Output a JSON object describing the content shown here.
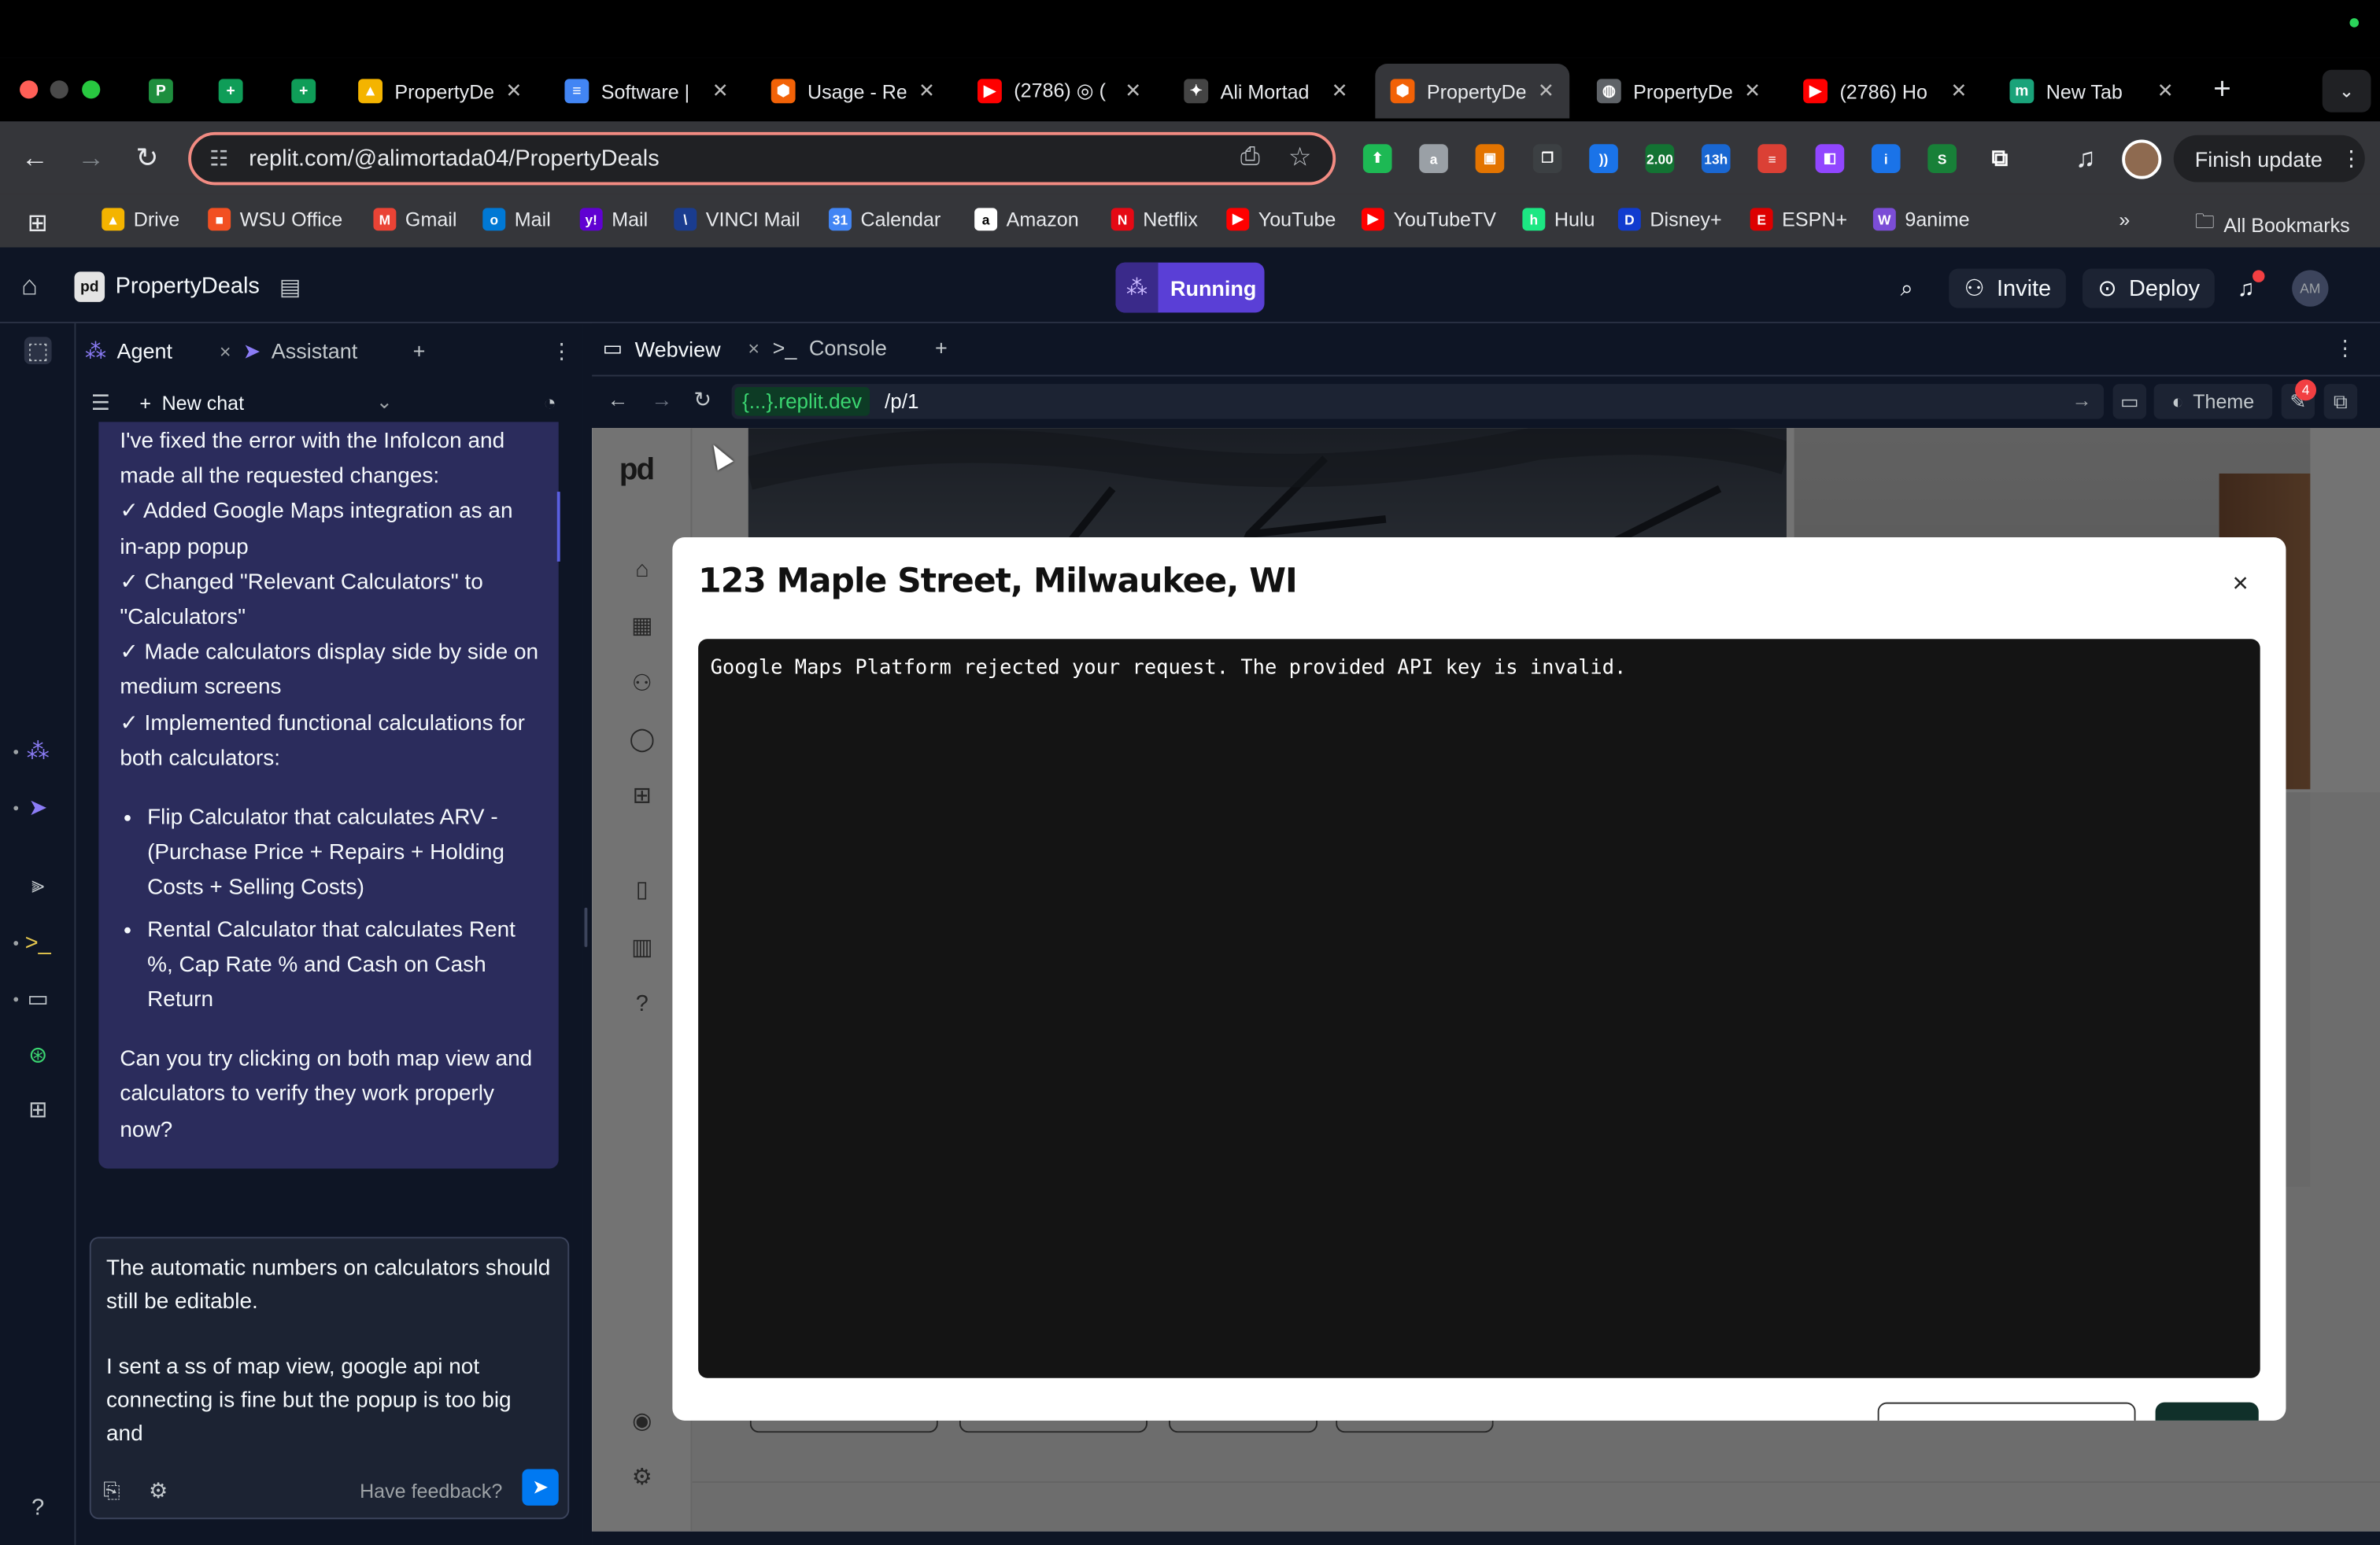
{
  "browser": {
    "tabs": [
      {
        "title": "",
        "icon": "profile-icon",
        "color": "#1e8e3e",
        "letter": "P"
      },
      {
        "title": "",
        "icon": "sheets-icon",
        "color": "#0f9d58",
        "letter": "+"
      },
      {
        "title": "",
        "icon": "sheets-icon",
        "color": "#0f9d58",
        "letter": "+"
      },
      {
        "title": "PropertyDe",
        "icon": "drive-icon",
        "color": "#f4b400",
        "letter": "▲"
      },
      {
        "title": "Software |",
        "icon": "docs-icon",
        "color": "#4285f4",
        "letter": "≡"
      },
      {
        "title": "Usage - Re",
        "icon": "replit-icon",
        "color": "#f26207",
        "letter": "⬢"
      },
      {
        "title": "(2786) ◎ (",
        "icon": "youtube-icon",
        "color": "#ff0000",
        "letter": "▶"
      },
      {
        "title": "Ali Mortad",
        "icon": "openai-icon",
        "color": "#444444",
        "letter": "✦"
      },
      {
        "title": "PropertyDe",
        "icon": "replit-icon",
        "color": "#f26207",
        "letter": "⬢"
      },
      {
        "title": "PropertyDe",
        "icon": "globe-icon",
        "color": "#5f6368",
        "letter": "◍"
      },
      {
        "title": "(2786) Ho",
        "icon": "youtube-icon",
        "color": "#ff0000",
        "letter": "▶"
      },
      {
        "title": "New Tab",
        "icon": "monica-icon",
        "color": "#1aa37a",
        "letter": "m"
      }
    ],
    "url": "replit.com/@alimortada04/PropertyDeals",
    "finish_update": "Finish update",
    "extensions": [
      {
        "icon": "ext-green-icon",
        "color": "#1db954",
        "label": "⬆"
      },
      {
        "icon": "ext-grey-icon",
        "color": "#9aa0a6",
        "label": "a"
      },
      {
        "icon": "ext-orange-icon",
        "color": "#e37400",
        "label": "▣"
      },
      {
        "icon": "ext-window-icon",
        "color": "#3c4043",
        "label": "❐"
      },
      {
        "icon": "ext-wave-icon",
        "color": "#1a73e8",
        "label": "))"
      },
      {
        "icon": "ext-speed-icon",
        "color": "#137333",
        "label": "2.00"
      },
      {
        "icon": "ext-timer-icon",
        "color": "#1967d2",
        "label": "13h"
      },
      {
        "icon": "ext-todoist-icon",
        "color": "#db4035",
        "label": "≡"
      },
      {
        "icon": "ext-twitch-icon",
        "color": "#9146ff",
        "label": "◧"
      },
      {
        "icon": "ext-info-icon",
        "color": "#1a73e8",
        "label": "i"
      },
      {
        "icon": "ext-s-icon",
        "color": "#188038",
        "label": "S"
      }
    ],
    "bookmarks": [
      {
        "label": "Drive",
        "icon": "drive-icon",
        "color": "#f4b400",
        "letter": "▲"
      },
      {
        "label": "WSU Office",
        "icon": "office-icon",
        "color": "#f25022",
        "letter": "■"
      },
      {
        "label": "Gmail",
        "icon": "gmail-icon",
        "color": "#ea4335",
        "letter": "M"
      },
      {
        "label": "Mail",
        "icon": "outlook-icon",
        "color": "#0078d4",
        "letter": "o"
      },
      {
        "label": "Mail",
        "icon": "yahoo-icon",
        "color": "#6001d2",
        "letter": "y!"
      },
      {
        "label": "VINCI Mail",
        "icon": "vinci-icon",
        "color": "#1a3c8f",
        "letter": "\\"
      },
      {
        "label": "Calendar",
        "icon": "calendar-icon",
        "color": "#4285f4",
        "letter": "31"
      },
      {
        "label": "Amazon",
        "icon": "amazon-icon",
        "color": "#ffffff",
        "letter": "a"
      },
      {
        "label": "Netflix",
        "icon": "netflix-icon",
        "color": "#e50914",
        "letter": "N"
      },
      {
        "label": "YouTube",
        "icon": "youtube-icon",
        "color": "#ff0000",
        "letter": "▶"
      },
      {
        "label": "YouTubeTV",
        "icon": "youtubetv-icon",
        "color": "#ff0000",
        "letter": "▶"
      },
      {
        "label": "Hulu",
        "icon": "hulu-icon",
        "color": "#1ce783",
        "letter": "h"
      },
      {
        "label": "Disney+",
        "icon": "disney-icon",
        "color": "#113ccf",
        "letter": "D"
      },
      {
        "label": "ESPN+",
        "icon": "espn-icon",
        "color": "#d00",
        "letter": "E"
      },
      {
        "label": "9anime",
        "icon": "anime-icon",
        "color": "#7b4dd6",
        "letter": "W"
      }
    ],
    "all_bookmarks": "All Bookmarks"
  },
  "replit": {
    "project_name": "PropertyDeals",
    "run_status": "Running",
    "invite": "Invite",
    "deploy": "Deploy",
    "user_initials": "AM",
    "agent_tabs": [
      "Agent",
      "Assistant"
    ],
    "new_chat": "New chat",
    "agent_message": {
      "intro": "I've fixed the error with the InfoIcon and made all the requested changes:",
      "checks": [
        "✓ Added Google Maps integration as an in-app popup",
        "✓ Changed \"Relevant Calculators\" to \"Calculators\"",
        "✓ Made calculators display side by side on medium screens",
        "✓ Implemented functional calculations for both calculators:"
      ],
      "bullets": [
        "Flip Calculator that calculates ARV - (Purchase Price + Repairs + Holding Costs + Selling Costs)",
        "Rental Calculator that calculates Rent %, Cap Rate % and Cash on Cash Return"
      ],
      "question": "Can you try clicking on both map view and calculators to verify they work properly now?"
    },
    "input_text_1": "The automatic numbers on calculators should still be editable.",
    "input_text_2": "I sent a ss of map view, google api not connecting is fine but the popup is too big and",
    "feedback": "Have feedback?",
    "webview_tabs": [
      "Webview",
      "Console"
    ],
    "webview_host": "{...}.replit.dev",
    "webview_path": "/p/1",
    "theme": "Theme",
    "notification_count": "4"
  },
  "app": {
    "logo": "pd",
    "modal": {
      "title": "123 Maple Street, Milwaukee, WI",
      "close": "×",
      "map_error": "Google Maps Platform rejected your request. The provided API key is invalid."
    }
  }
}
